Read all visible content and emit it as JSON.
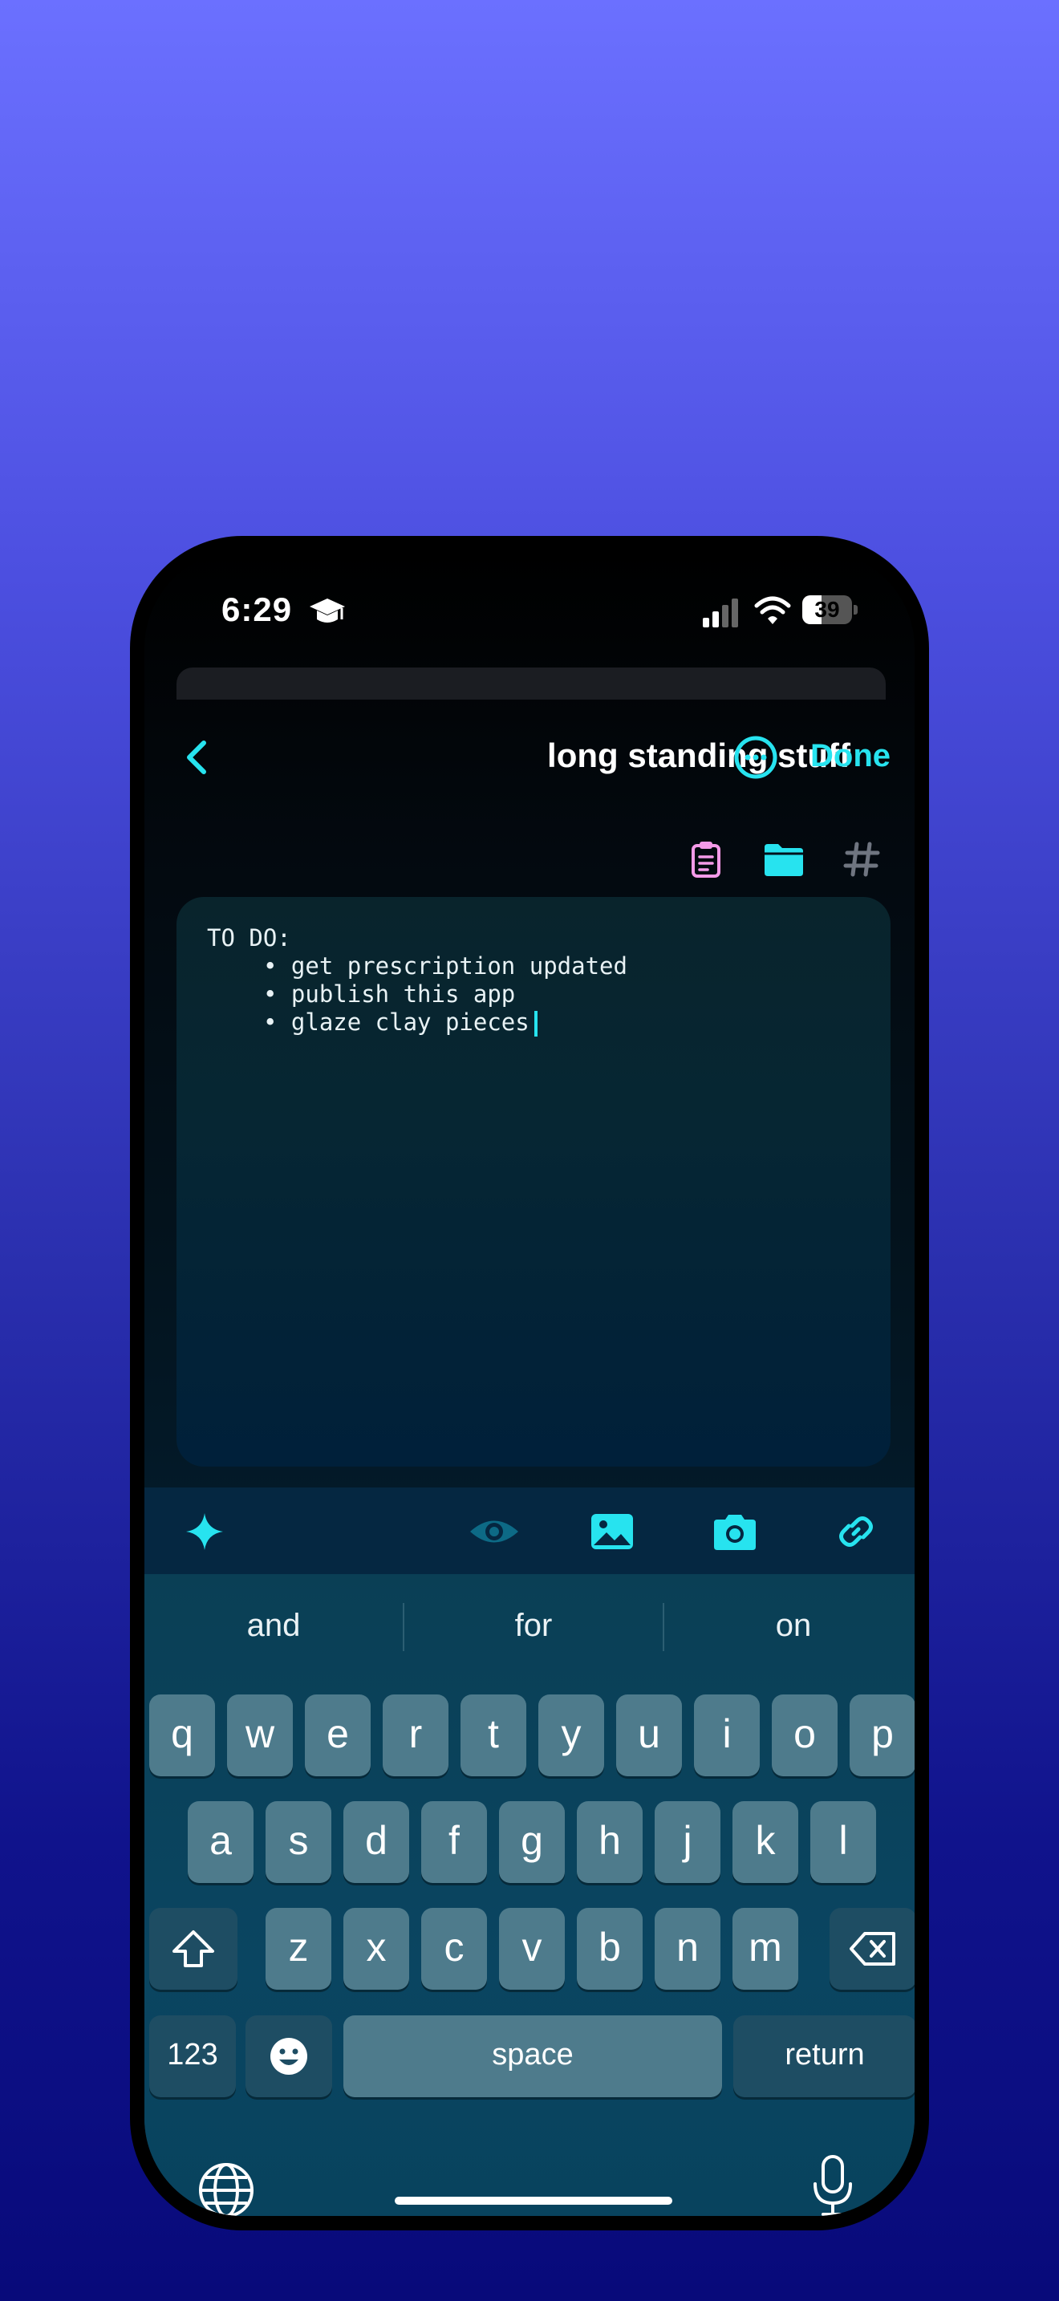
{
  "status_bar": {
    "time": "6:29",
    "battery": "39",
    "battery_level": 0.39
  },
  "nav": {
    "title": "long standing stuff",
    "done_label": "Done"
  },
  "note": {
    "heading": "TO DO:",
    "items": [
      "• get prescription updated",
      "• publish this app",
      "• glaze clay pieces"
    ]
  },
  "keyboard": {
    "suggestions": [
      "and",
      "for",
      "on"
    ],
    "row1": [
      "q",
      "w",
      "e",
      "r",
      "t",
      "y",
      "u",
      "i",
      "o",
      "p"
    ],
    "row2": [
      "a",
      "s",
      "d",
      "f",
      "g",
      "h",
      "j",
      "k",
      "l"
    ],
    "row3": [
      "z",
      "x",
      "c",
      "v",
      "b",
      "n",
      "m"
    ],
    "numbers_label": "123",
    "space_label": "space",
    "return_label": "return"
  },
  "colors": {
    "accent": "#27e3ef",
    "pink": "#f59ae8",
    "hash": "#6f7580"
  },
  "icons": [
    "graduation-cap-icon",
    "signal-icon",
    "wifi-icon",
    "back-chevron-icon",
    "more-icon",
    "clipboard-icon",
    "folder-icon",
    "hashtag-icon",
    "sparkle-icon",
    "eye-icon",
    "photo-icon",
    "camera-icon",
    "link-icon",
    "shift-icon",
    "backspace-icon",
    "emoji-icon",
    "globe-icon",
    "microphone-icon"
  ]
}
